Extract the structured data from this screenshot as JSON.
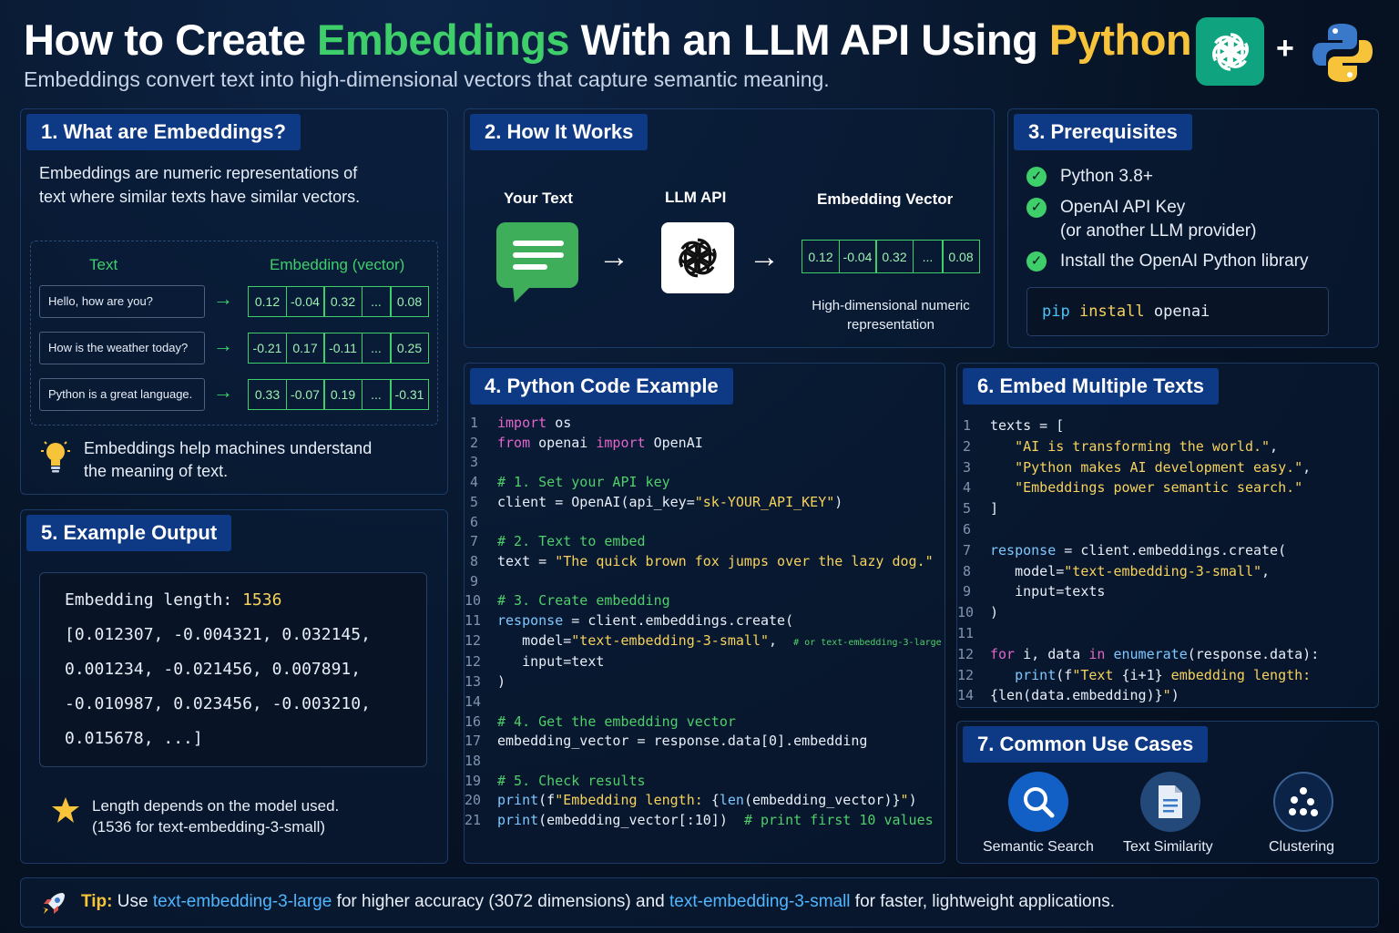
{
  "header": {
    "title_part1": "How to Create ",
    "title_green": "Embeddings",
    "title_part2": " With an LLM API Using ",
    "title_yellow": "Python",
    "subtitle": "Embeddings convert text into high-dimensional vectors that capture semantic meaning.",
    "plus": "+",
    "logos": [
      "openai-logo-icon",
      "python-logo-icon"
    ]
  },
  "colors": {
    "green": "#3fcf6a",
    "yellow": "#f6c33a",
    "accent_blue": "#0e3a85",
    "openai": "#10a37f"
  },
  "section1": {
    "title": "1. What are Embeddings?",
    "description": "Embeddings are numeric representations of text where similar texts have similar vectors.",
    "col_text": "Text",
    "col_embedding": "Embedding (vector)",
    "rows": [
      {
        "text": "Hello, how are you?",
        "vector": [
          "0.12",
          "-0.04",
          "0.32",
          "...",
          "0.08"
        ]
      },
      {
        "text": "How is the weather today?",
        "vector": [
          "-0.21",
          "0.17",
          "-0.11",
          "...",
          "0.25"
        ]
      },
      {
        "text": "Python is a great language.",
        "vector": [
          "0.33",
          "-0.07",
          "0.19",
          "...",
          "-0.31"
        ]
      }
    ],
    "note": "Embeddings help machines understand the meaning of text."
  },
  "section2": {
    "title": "2. How It Works",
    "label_text": "Your Text",
    "label_api": "LLM API",
    "label_vector": "Embedding Vector",
    "arrow": "→",
    "vector": [
      "0.12",
      "-0.04",
      "0.32",
      "...",
      "0.08"
    ],
    "caption": "High-dimensional numeric representation"
  },
  "section3": {
    "title": "3. Prerequisites",
    "items": [
      {
        "text": "Python 3.8+",
        "sub": ""
      },
      {
        "text": "OpenAI API Key",
        "sub": "(or another LLM provider)"
      },
      {
        "text": "Install the OpenAI Python library",
        "sub": ""
      }
    ],
    "pip_cmd": "pip",
    "pip_sub": "install",
    "pip_pkg": "openai"
  },
  "section4": {
    "title": "4. Python Code Example",
    "lines": [
      {
        "n": "1",
        "parts": [
          [
            "kw",
            "import"
          ],
          [
            "pl",
            " os"
          ]
        ]
      },
      {
        "n": "2",
        "parts": [
          [
            "kw",
            "from"
          ],
          [
            "pl",
            " openai "
          ],
          [
            "kw",
            "import"
          ],
          [
            "pl",
            " OpenAI"
          ]
        ]
      },
      {
        "n": "3",
        "parts": []
      },
      {
        "n": "4",
        "parts": [
          [
            "cm",
            "# 1. Set your API key"
          ]
        ]
      },
      {
        "n": "5",
        "parts": [
          [
            "pl",
            "client = OpenAI(api_key="
          ],
          [
            "str",
            "\"sk-YOUR_API_KEY\""
          ],
          [
            "pl",
            ")"
          ]
        ]
      },
      {
        "n": "6",
        "parts": []
      },
      {
        "n": "7",
        "parts": [
          [
            "cm",
            "# 2. Text to embed"
          ]
        ]
      },
      {
        "n": "8",
        "parts": [
          [
            "pl",
            "text = "
          ],
          [
            "str",
            "\"The quick brown fox jumps over the lazy dog.\""
          ]
        ]
      },
      {
        "n": "9",
        "parts": []
      },
      {
        "n": "10",
        "parts": [
          [
            "cm",
            "# 3. Create embedding"
          ]
        ]
      },
      {
        "n": "11",
        "parts": [
          [
            "fn",
            "response"
          ],
          [
            "pl",
            " = client.embeddings.create("
          ]
        ]
      },
      {
        "n": "12",
        "parts": [
          [
            "pl",
            "   model="
          ],
          [
            "str",
            "\"text-embedding-3-small\""
          ],
          [
            "pl",
            ",  "
          ],
          [
            "smallcm",
            "# or text-embedding-3-large"
          ]
        ]
      },
      {
        "n": "12",
        "parts": [
          [
            "pl",
            "   input=text"
          ]
        ]
      },
      {
        "n": "13",
        "parts": [
          [
            "pl",
            ")"
          ]
        ]
      },
      {
        "n": "14",
        "parts": []
      },
      {
        "n": "16",
        "parts": [
          [
            "cm",
            "# 4. Get the embedding vector"
          ]
        ]
      },
      {
        "n": "17",
        "parts": [
          [
            "pl",
            "embedding_vector = response.data[0].embedding"
          ]
        ]
      },
      {
        "n": "18",
        "parts": []
      },
      {
        "n": "19",
        "parts": [
          [
            "cm",
            "# 5. Check results"
          ]
        ]
      },
      {
        "n": "20",
        "parts": [
          [
            "fn",
            "print"
          ],
          [
            "pl",
            "(f"
          ],
          [
            "str",
            "\"Embedding length: "
          ],
          [
            "pl",
            "{"
          ],
          [
            "fn",
            "len"
          ],
          [
            "pl",
            "(embedding_vector)}"
          ],
          [
            "str",
            "\""
          ],
          [
            "pl",
            ")"
          ]
        ]
      },
      {
        "n": "21",
        "parts": [
          [
            "fn",
            "print"
          ],
          [
            "pl",
            "(embedding_vector[:10])  "
          ],
          [
            "cm",
            "# print first 10 values"
          ]
        ]
      }
    ]
  },
  "section5": {
    "title": "5. Example Output",
    "length_label": "Embedding length: ",
    "length_value": "1536",
    "values": [
      "[0.012307, -0.004321, 0.032145,",
      "0.001234, -0.021456, 0.007891,",
      "-0.010987, 0.023456, -0.003210,",
      "0.015678, ...]"
    ],
    "note_line1": "Length depends on the model used.",
    "note_line2": "(1536 for text-embedding-3-small)"
  },
  "section6": {
    "title": "6. Embed Multiple Texts",
    "lines": [
      {
        "n": "1",
        "parts": [
          [
            "pl",
            "texts = ["
          ]
        ]
      },
      {
        "n": "2",
        "parts": [
          [
            "str",
            "   \"AI is transforming the world.\""
          ],
          [
            "pl",
            ","
          ]
        ]
      },
      {
        "n": "3",
        "parts": [
          [
            "str",
            "   \"Python makes AI development easy.\""
          ],
          [
            "pl",
            ","
          ]
        ]
      },
      {
        "n": "4",
        "parts": [
          [
            "str",
            "   \"Embeddings power semantic search.\""
          ]
        ]
      },
      {
        "n": "5",
        "parts": [
          [
            "pl",
            "]"
          ]
        ]
      },
      {
        "n": "6",
        "parts": []
      },
      {
        "n": "7",
        "parts": [
          [
            "fn",
            "response"
          ],
          [
            "pl",
            " = client.embeddings.create("
          ]
        ]
      },
      {
        "n": "8",
        "parts": [
          [
            "pl",
            "   model="
          ],
          [
            "str",
            "\"text-embedding-3-small\""
          ],
          [
            "pl",
            ","
          ]
        ]
      },
      {
        "n": "9",
        "parts": [
          [
            "pl",
            "   input=texts"
          ]
        ]
      },
      {
        "n": "10",
        "parts": [
          [
            "pl",
            ")"
          ]
        ]
      },
      {
        "n": "11",
        "parts": []
      },
      {
        "n": "12",
        "parts": [
          [
            "kw",
            "for"
          ],
          [
            "pl",
            " i, data "
          ],
          [
            "kw",
            "in"
          ],
          [
            "fn",
            " enumerate"
          ],
          [
            "pl",
            "(response.data):"
          ]
        ]
      },
      {
        "n": "12",
        "parts": [
          [
            "fn",
            "   print"
          ],
          [
            "pl",
            "(f"
          ],
          [
            "str",
            "\"Text "
          ],
          [
            "pl",
            "{i+1}"
          ],
          [
            "str",
            " embedding length:"
          ]
        ]
      },
      {
        "n": "14",
        "parts": [
          [
            "pl",
            "{len(data.embedding)}"
          ],
          [
            "str",
            "\""
          ],
          [
            "pl",
            ")"
          ]
        ]
      }
    ]
  },
  "section7": {
    "title": "7. Common Use Cases",
    "items": [
      {
        "label": "Semantic Search",
        "icon": "search-icon"
      },
      {
        "label": "Text Similarity",
        "icon": "document-icon"
      },
      {
        "label": "Clustering",
        "icon": "clustering-icon"
      }
    ]
  },
  "tip": {
    "icon": "rocket-icon",
    "label": "Tip:",
    "part1": " Use ",
    "model_large": "text-embedding-3-large",
    "part2": " for higher accuracy (3072 dimensions) and ",
    "model_small": "text-embedding-3-small",
    "part3": " for faster, lightweight applications."
  }
}
